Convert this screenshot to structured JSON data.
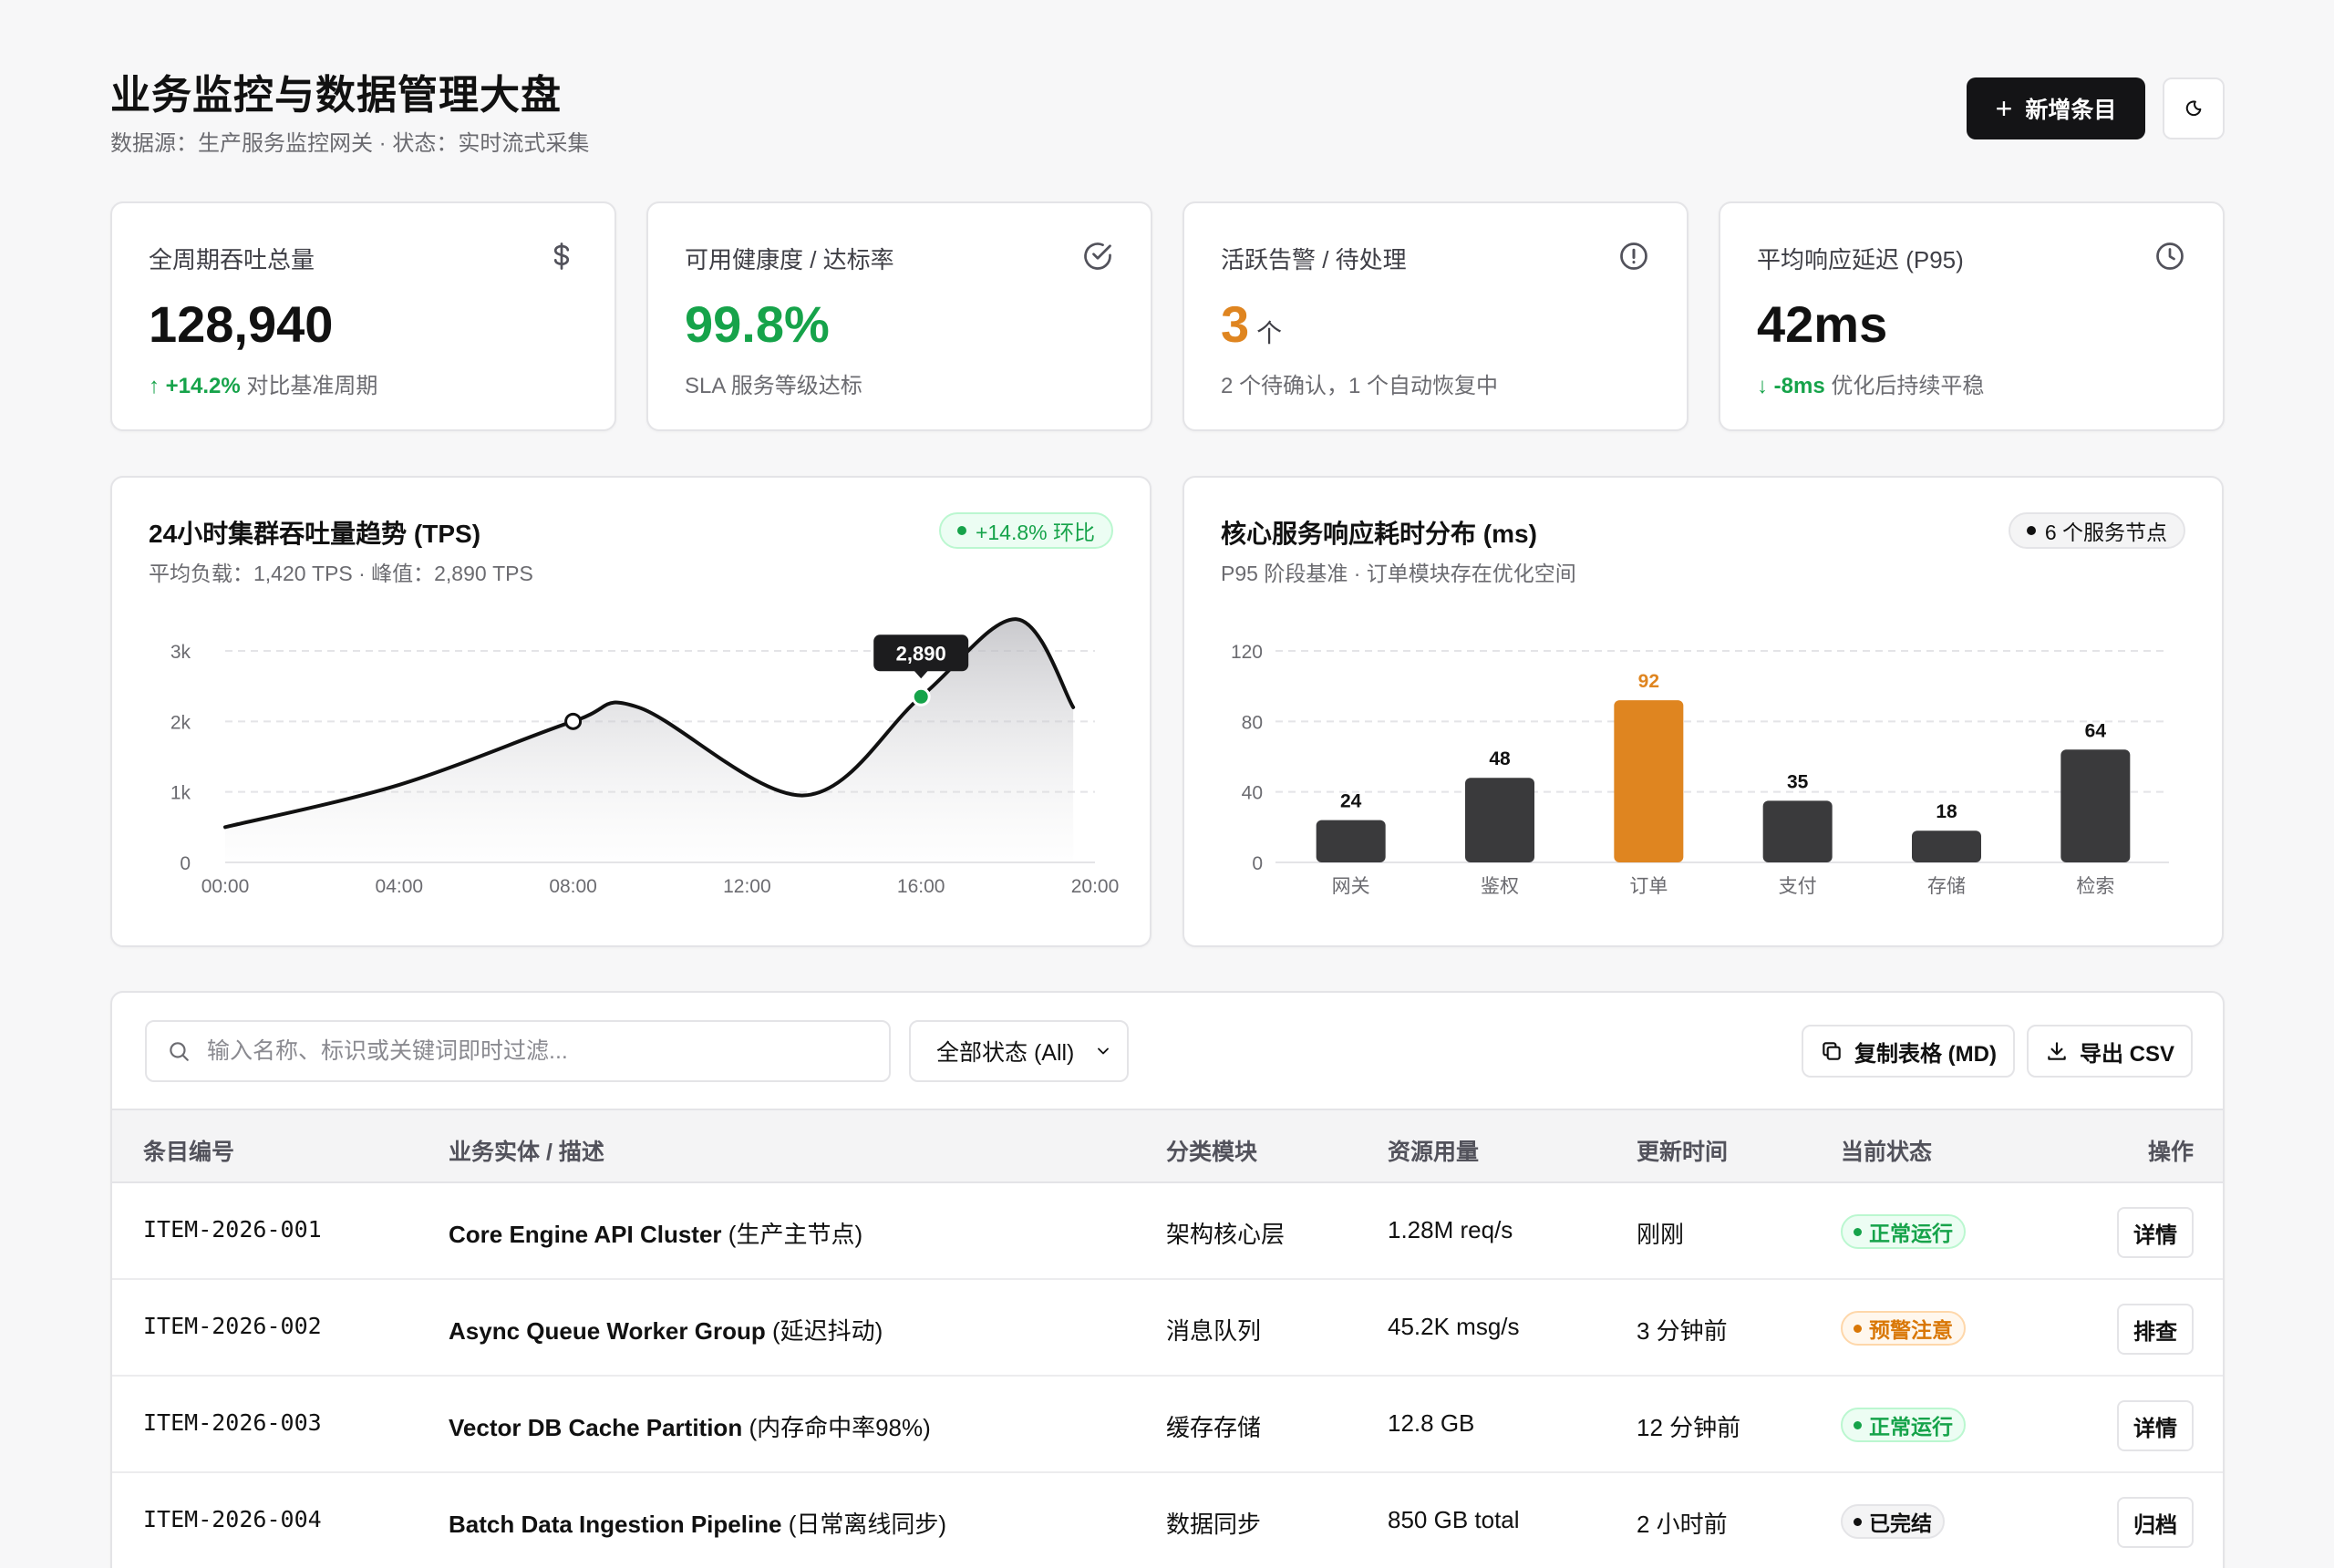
{
  "header": {
    "title": "业务监控与数据管理大盘",
    "subtitle": "数据源：生产服务监控网关 · 状态：实时流式采集",
    "add_label": "新增条目"
  },
  "kpis": [
    {
      "label": "全周期吞吐总量",
      "icon": "dollar-icon",
      "value": "128,940",
      "delta": "↑ +14.2%",
      "note": "对比基准周期"
    },
    {
      "label": "可用健康度 / 达标率",
      "icon": "check-circle-icon",
      "value": "99.8%",
      "note": "SLA 服务等级达标"
    },
    {
      "label": "活跃告警 / 待处理",
      "icon": "alert-circle-icon",
      "value": "3",
      "unit": "个",
      "note": "2 个待确认，1 个自动恢复中"
    },
    {
      "label": "平均响应延迟 (P95)",
      "icon": "clock-icon",
      "value": "42ms",
      "delta": "↓ -8ms",
      "note": "优化后持续平稳"
    }
  ],
  "colors": {
    "green": "#16a34a",
    "orange": "#df8520",
    "dark": "#3a3a3c",
    "warn": "#d97706"
  },
  "line_card": {
    "title": "24小时集群吞吐量趋势 (TPS)",
    "subtitle": "平均负载：1,420 TPS · 峰值：2,890 TPS",
    "badge": "+14.8% 环比"
  },
  "bar_card": {
    "title": "核心服务响应耗时分布 (ms)",
    "subtitle": "P95 阶段基准 · 订单模块存在优化空间",
    "badge": "6 个服务节点"
  },
  "chart_data": [
    {
      "type": "area",
      "x_ticks": [
        "00:00",
        "04:00",
        "08:00",
        "12:00",
        "16:00",
        "20:00"
      ],
      "y_ticks": [
        "0",
        "1k",
        "2k",
        "3k"
      ],
      "ylim": [
        0,
        3000
      ],
      "grid": true,
      "series": [
        {
          "x": [
            0,
            4,
            8,
            9.5,
            13.3,
            16,
            18.2,
            19.5
          ],
          "values": [
            500,
            1100,
            2000,
            2200,
            950,
            2350,
            3450,
            2200
          ]
        }
      ],
      "markers": [
        {
          "x": 8,
          "y": 2000,
          "style": "hollow"
        },
        {
          "x": 16,
          "y": 2350,
          "style": "highlight",
          "label": "2,890"
        }
      ]
    },
    {
      "type": "bar",
      "categories": [
        "网关",
        "鉴权",
        "订单",
        "支付",
        "存储",
        "检索"
      ],
      "values": [
        24,
        48,
        92,
        35,
        18,
        64
      ],
      "y_ticks": [
        "0",
        "40",
        "80",
        "120"
      ],
      "ylim": [
        0,
        120
      ],
      "highlight_index": 2,
      "grid": true
    }
  ],
  "table": {
    "search_placeholder": "输入名称、标识或关键词即时过滤...",
    "filter_value": "全部状态 (All)",
    "copy_label": "复制表格 (MD)",
    "export_label": "导出 CSV",
    "columns": [
      "条目编号",
      "业务实体 / 描述",
      "分类模块",
      "资源用量",
      "更新时间",
      "当前状态",
      "操作"
    ],
    "rows": [
      {
        "id": "ITEM-2026-001",
        "name": "Core Engine API Cluster",
        "desc": "(生产主节点)",
        "category": "架构核心层",
        "usage": "1.28M req/s",
        "updated": "刚刚",
        "status": "正常运行",
        "status_type": "ok",
        "action": "详情"
      },
      {
        "id": "ITEM-2026-002",
        "name": "Async Queue Worker Group",
        "desc": "(延迟抖动)",
        "category": "消息队列",
        "usage": "45.2K msg/s",
        "updated": "3 分钟前",
        "status": "预警注意",
        "status_type": "warn",
        "action": "排查"
      },
      {
        "id": "ITEM-2026-003",
        "name": "Vector DB Cache Partition",
        "desc": "(内存命中率98%)",
        "category": "缓存存储",
        "usage": "12.8 GB",
        "updated": "12 分钟前",
        "status": "正常运行",
        "status_type": "ok",
        "action": "详情"
      },
      {
        "id": "ITEM-2026-004",
        "name": "Batch Data Ingestion Pipeline",
        "desc": "(日常离线同步)",
        "category": "数据同步",
        "usage": "850 GB total",
        "updated": "2 小时前",
        "status": "已完结",
        "status_type": "done",
        "action": "归档"
      }
    ]
  }
}
